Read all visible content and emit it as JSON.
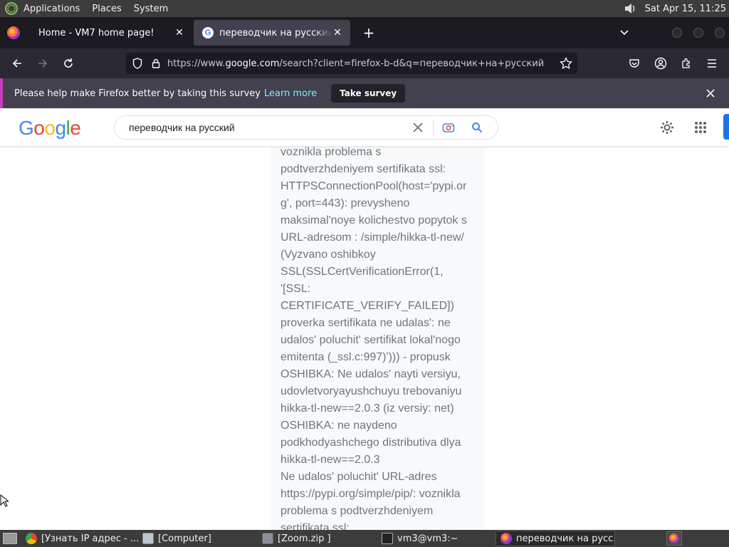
{
  "panel": {
    "menus": [
      "Applications",
      "Places",
      "System"
    ],
    "clock": "Sat Apr 15, 11:25"
  },
  "tabs": [
    {
      "title": "Home - VM7 home page!",
      "active": false
    },
    {
      "title": "переводчик на русский - Google",
      "active": true
    }
  ],
  "navbar": {
    "url_prefix": "https://www.",
    "url_host": "google.com",
    "url_path": "/search?client=firefox-b-d&q=переводчик+на+русский"
  },
  "notification": {
    "text": "Please help make Firefox better by taking this survey",
    "link": "Learn more",
    "button": "Take survey"
  },
  "google": {
    "logo_letters": [
      {
        "ch": "G",
        "color": "#4285F4"
      },
      {
        "ch": "o",
        "color": "#EA4335"
      },
      {
        "ch": "o",
        "color": "#FBBC05"
      },
      {
        "ch": "g",
        "color": "#4285F4"
      },
      {
        "ch": "l",
        "color": "#34A853"
      },
      {
        "ch": "e",
        "color": "#EA4335"
      }
    ],
    "query": "переводчик на русский"
  },
  "snippet": "voznikla problema s\npodtverzhdeniyem sertifikata ssl:\nHTTPSConnectionPool(host='pypi.org', port=443): prevysheno\nmaksimal'noye kolichestvo popytok s\nURL-adresom : /simple/hikka-tl-new/\n(Vyzvano oshibkoy\nSSL(SSLCertVerificationError(1,\n'[SSL:\nCERTIFICATE_VERIFY_FAILED])\nproverka sertifikata ne udalas': ne\nudalos' poluchit' sertifikat lokal'nogo\nemitenta (_ssl.c:997)'))) - propusk\nOSHIBKA: Ne udalos' nayti versiyu,\nudovletvoryayushchuyu trebovaniyu\nhikka-tl-new==2.0.3 (iz versiy: net)\nOSHIBKA: ne naydeno\npodkhodyashchego distributiva dlya\nhikka-tl-new==2.0.3\nNe udalos' poluchit' URL-adres\nhttps://pypi.org/simple/pip/: voznikla\nproblema s podtverzhdeniyem\nsertifikata ssl:",
  "taskbar": [
    {
      "label": "[Узнать IP адрес - ...",
      "icon": "chrome-icon",
      "active": false
    },
    {
      "label": "[Computer]",
      "icon": "computer-icon",
      "active": false
    },
    {
      "label": "[Zoom.zip ]",
      "icon": "archive-icon",
      "active": false
    },
    {
      "label": "vm3@vm3:~",
      "icon": "terminal-icon",
      "active": false
    },
    {
      "label": "переводчик на русс...",
      "icon": "firefox-icon",
      "active": true
    }
  ]
}
